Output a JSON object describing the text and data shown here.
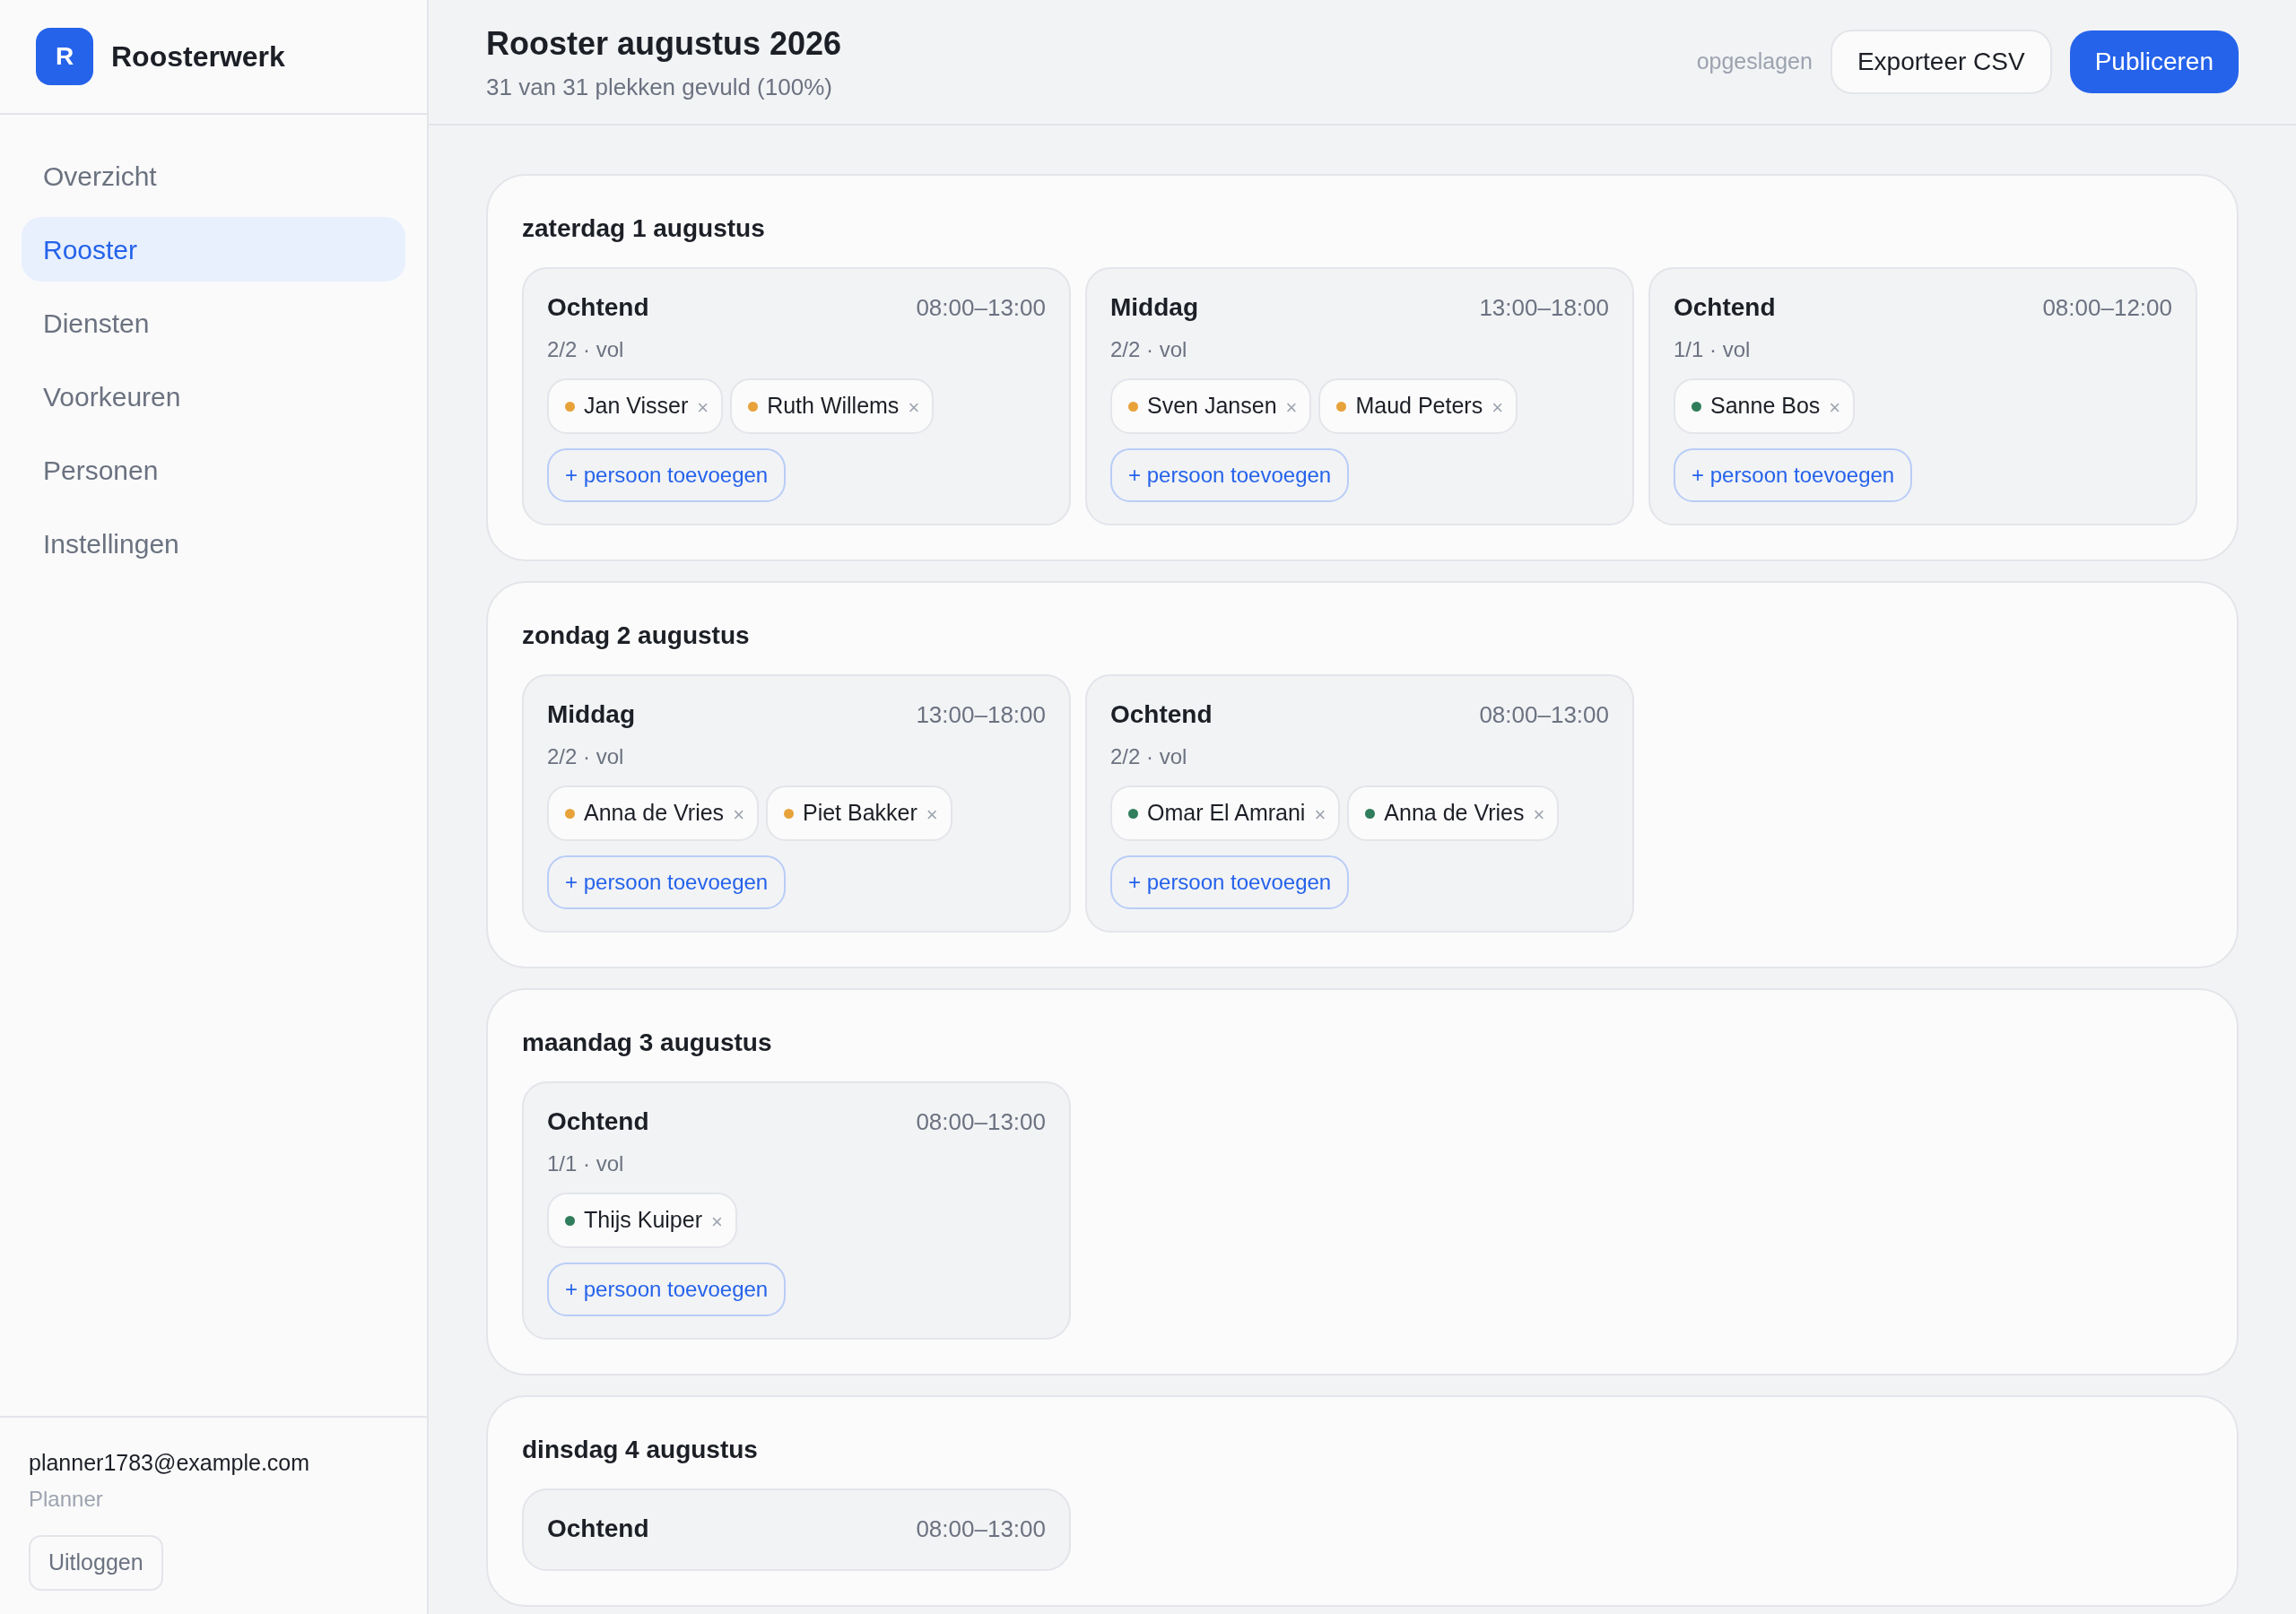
{
  "brand": {
    "initial": "R",
    "name": "Roosterwerk"
  },
  "nav": [
    {
      "label": "Overzicht",
      "selected": false
    },
    {
      "label": "Rooster",
      "selected": true
    },
    {
      "label": "Diensten",
      "selected": false
    },
    {
      "label": "Voorkeuren",
      "selected": false
    },
    {
      "label": "Personen",
      "selected": false
    },
    {
      "label": "Instellingen",
      "selected": false
    }
  ],
  "user": {
    "email": "planner1783@example.com",
    "role": "Planner",
    "logout": "Uitloggen"
  },
  "header": {
    "title": "Rooster augustus 2026",
    "subtitle": "31 van 31 plekken gevuld (100%)",
    "status": "opgeslagen",
    "export": "Exporteer CSV",
    "publish": "Publiceren"
  },
  "days": [
    {
      "title": "zaterdag 1 augustus",
      "shifts": [
        {
          "name": "Ochtend",
          "time": "08:00–13:00",
          "fill": "2/2 · vol",
          "people": [
            {
              "name": "Jan Visser",
              "color": "#e8a23a",
              "remove": "×"
            },
            {
              "name": "Ruth Willems",
              "color": "#e8a23a",
              "remove": "×"
            }
          ],
          "add": "+ persoon toevoegen"
        },
        {
          "name": "Middag",
          "time": "13:00–18:00",
          "fill": "2/2 · vol",
          "people": [
            {
              "name": "Sven Jansen",
              "color": "#e8a23a",
              "remove": "×"
            },
            {
              "name": "Maud Peters",
              "color": "#e8a23a",
              "remove": "×"
            }
          ],
          "add": "+ persoon toevoegen"
        },
        {
          "name": "Ochtend",
          "time": "08:00–12:00",
          "fill": "1/1 · vol",
          "people": [
            {
              "name": "Sanne Bos",
              "color": "#2f7d5b",
              "remove": "×"
            }
          ],
          "add": "+ persoon toevoegen"
        }
      ]
    },
    {
      "title": "zondag 2 augustus",
      "shifts": [
        {
          "name": "Middag",
          "time": "13:00–18:00",
          "fill": "2/2 · vol",
          "people": [
            {
              "name": "Anna de Vries",
              "color": "#e8a23a",
              "remove": "×"
            },
            {
              "name": "Piet Bakker",
              "color": "#e8a23a",
              "remove": "×"
            }
          ],
          "add": "+ persoon toevoegen"
        },
        {
          "name": "Ochtend",
          "time": "08:00–13:00",
          "fill": "2/2 · vol",
          "people": [
            {
              "name": "Omar El Amrani",
              "color": "#2f7d5b",
              "remove": "×"
            },
            {
              "name": "Anna de Vries",
              "color": "#2f7d5b",
              "remove": "×"
            }
          ],
          "add": "+ persoon toevoegen"
        }
      ]
    },
    {
      "title": "maandag 3 augustus",
      "shifts": [
        {
          "name": "Ochtend",
          "time": "08:00–13:00",
          "fill": "1/1 · vol",
          "people": [
            {
              "name": "Thijs Kuiper",
              "color": "#2f7d5b",
              "remove": "×"
            }
          ],
          "add": "+ persoon toevoegen"
        }
      ]
    },
    {
      "title": "dinsdag 4 augustus",
      "shifts": [
        {
          "name": "Ochtend",
          "time": "08:00–13:00"
        }
      ]
    }
  ]
}
